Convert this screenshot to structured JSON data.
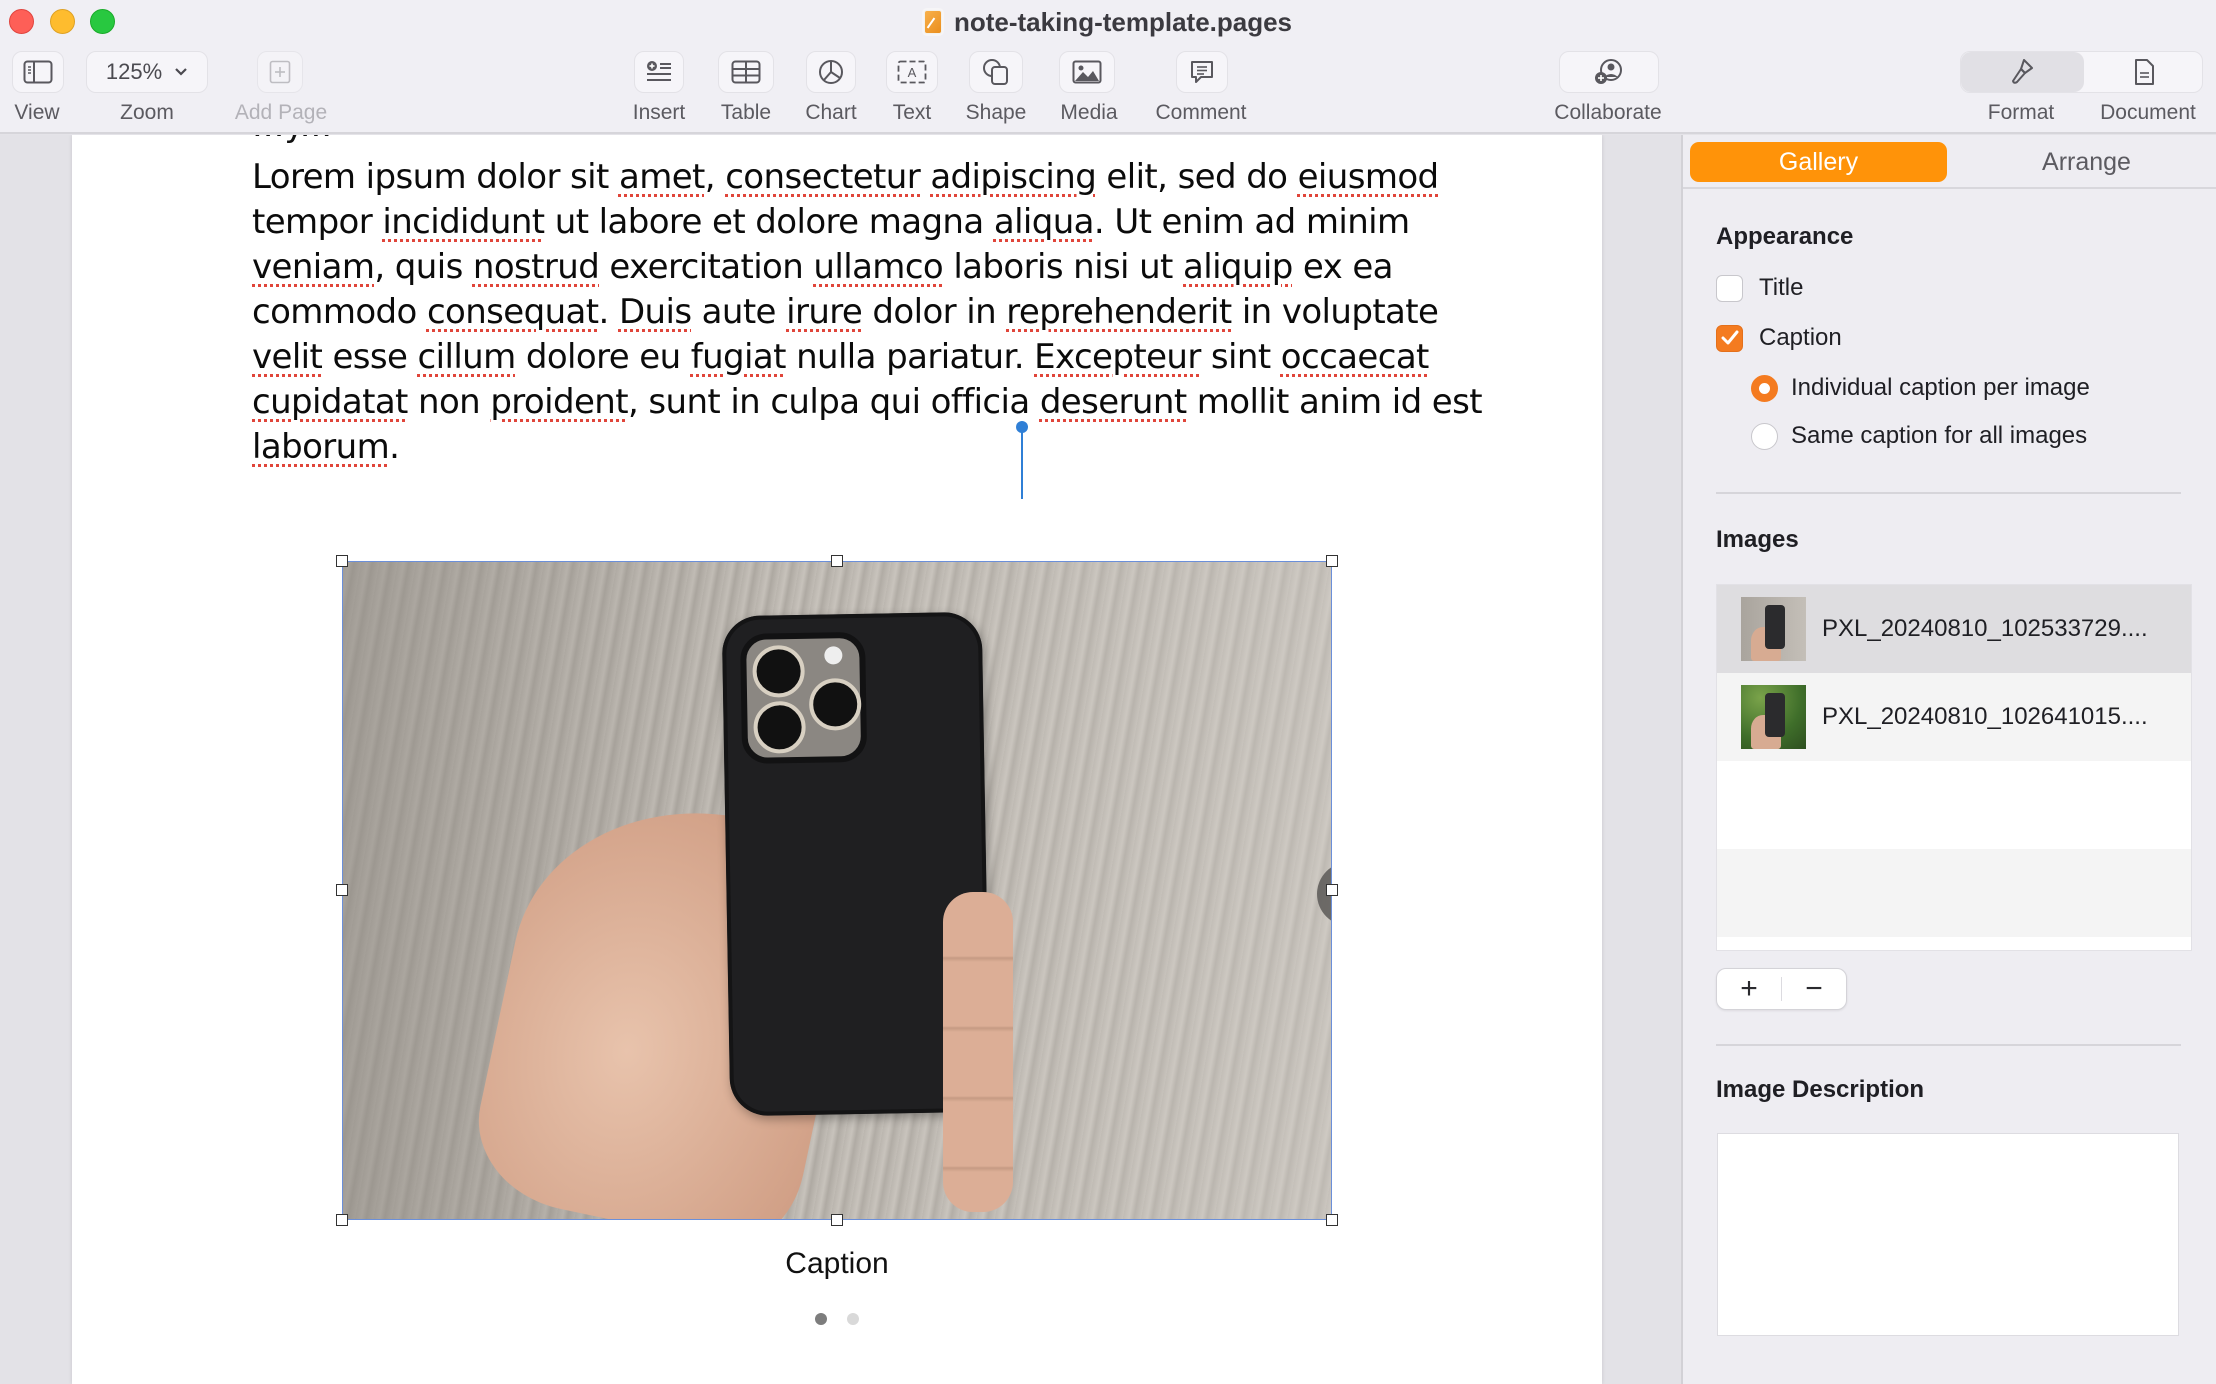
{
  "window": {
    "title": "note-taking-template.pages"
  },
  "toolbar": {
    "view_label": "View",
    "zoom_value": "125%",
    "zoom_label": "Zoom",
    "add_page_label": "Add Page",
    "insert_label": "Insert",
    "table_label": "Table",
    "chart_label": "Chart",
    "text_label": "Text",
    "shape_label": "Shape",
    "media_label": "Media",
    "comment_label": "Comment",
    "collaborate_label": "Collaborate",
    "format_label": "Format",
    "document_label": "Document"
  },
  "document": {
    "cutoff_text": "...y...",
    "paragraph_segments": [
      {
        "t": "Lorem ipsum dolor sit ",
        "s": false
      },
      {
        "t": "amet",
        "s": true
      },
      {
        "t": ", ",
        "s": false
      },
      {
        "t": "consectetur",
        "s": true
      },
      {
        "t": " ",
        "s": false
      },
      {
        "t": "adipiscing",
        "s": true
      },
      {
        "t": " elit, sed do ",
        "s": false
      },
      {
        "t": "eiusmod",
        "s": true
      },
      {
        "t": " tempor ",
        "s": false
      },
      {
        "t": "incididunt",
        "s": true
      },
      {
        "t": " ut labore et dolore magna ",
        "s": false
      },
      {
        "t": "aliqua",
        "s": true
      },
      {
        "t": ". Ut enim ad minim ",
        "s": false
      },
      {
        "t": "veniam",
        "s": true
      },
      {
        "t": ", quis ",
        "s": false
      },
      {
        "t": "nostrud",
        "s": true
      },
      {
        "t": " exercitation ",
        "s": false
      },
      {
        "t": "ullamco",
        "s": true
      },
      {
        "t": " laboris nisi ut ",
        "s": false
      },
      {
        "t": "aliquip",
        "s": true
      },
      {
        "t": " ex ea commodo ",
        "s": false
      },
      {
        "t": "consequat",
        "s": true
      },
      {
        "t": ". ",
        "s": false
      },
      {
        "t": "Duis",
        "s": true
      },
      {
        "t": " aute ",
        "s": false
      },
      {
        "t": "irure",
        "s": true
      },
      {
        "t": " dolor in ",
        "s": false
      },
      {
        "t": "reprehenderit",
        "s": true
      },
      {
        "t": " in voluptate ",
        "s": false
      },
      {
        "t": "velit",
        "s": true
      },
      {
        "t": " esse ",
        "s": false
      },
      {
        "t": "cillum",
        "s": true
      },
      {
        "t": " dolore eu ",
        "s": false
      },
      {
        "t": "fugiat",
        "s": true
      },
      {
        "t": " nulla pariatur. ",
        "s": false
      },
      {
        "t": "Excepteur",
        "s": true
      },
      {
        "t": " sint ",
        "s": false
      },
      {
        "t": "occaecat",
        "s": true
      },
      {
        "t": " ",
        "s": false
      },
      {
        "t": "cupidatat",
        "s": true
      },
      {
        "t": " non ",
        "s": false
      },
      {
        "t": "proident",
        "s": true
      },
      {
        "t": ", sunt in culpa qui officia ",
        "s": false
      },
      {
        "t": "deserunt",
        "s": true
      },
      {
        "t": " mollit anim id est ",
        "s": false
      },
      {
        "t": "laborum",
        "s": true
      },
      {
        "t": ".",
        "s": false
      }
    ],
    "gallery": {
      "caption": "Caption",
      "image_count": 2,
      "current_index": 1
    }
  },
  "sidebar": {
    "tabs": [
      {
        "label": "Gallery",
        "active": true
      },
      {
        "label": "Arrange",
        "active": false
      }
    ],
    "appearance": {
      "title": "Appearance",
      "title_checkbox_label": "Title",
      "title_checked": false,
      "caption_checkbox_label": "Caption",
      "caption_checked": true,
      "radio_individual_label": "Individual caption per image",
      "radio_same_label": "Same caption for all images",
      "selected_radio": "individual"
    },
    "images": {
      "title": "Images",
      "items": [
        {
          "name": "PXL_20240810_102533729....",
          "selected": true
        },
        {
          "name": "PXL_20240810_102641015....",
          "selected": false
        }
      ],
      "add_label": "+",
      "remove_label": "−"
    },
    "image_description": {
      "title": "Image Description",
      "value": ""
    }
  },
  "colors": {
    "accent": "#ff9309",
    "checkbox_accent": "#f47b20",
    "spellcheck": "#e0453a",
    "cursor": "#2f7fd6",
    "selection_border": "#6b8fd9"
  }
}
